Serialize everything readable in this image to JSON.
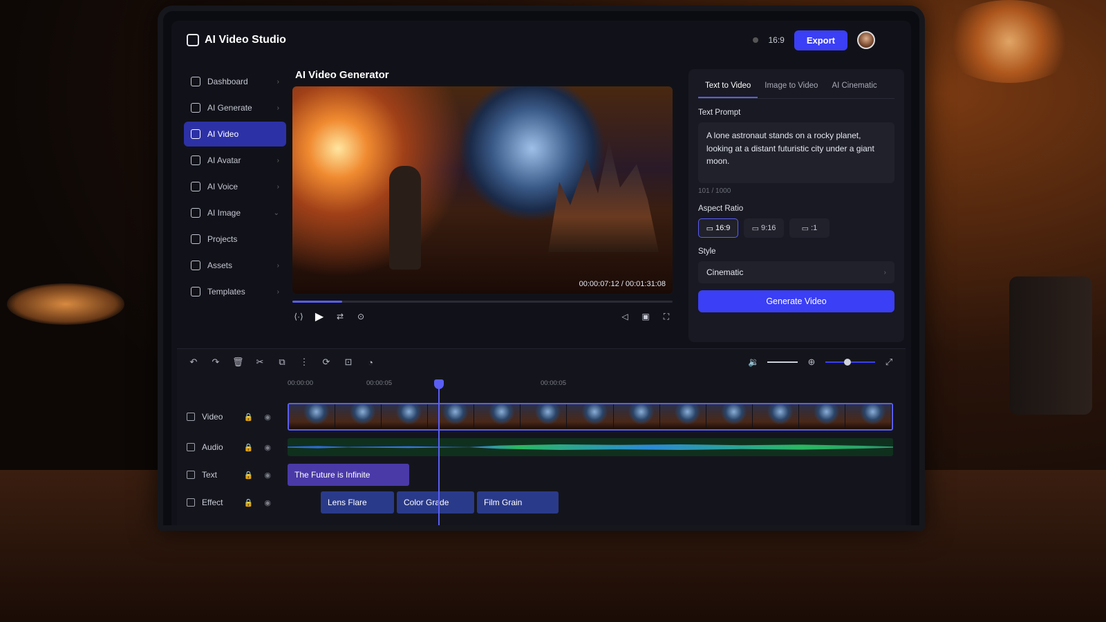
{
  "app": {
    "title": "AI Video Studio"
  },
  "topbar": {
    "ratio": "16:9",
    "export_label": "Export"
  },
  "sidebar": {
    "items": [
      {
        "label": "Dashboard",
        "icon": "home-icon",
        "active": false
      },
      {
        "label": "AI Generate",
        "icon": "sparkle-icon",
        "active": false
      },
      {
        "label": "AI Video",
        "icon": "video-icon",
        "active": true
      },
      {
        "label": "AI Avatar",
        "icon": "user-icon",
        "active": false
      },
      {
        "label": "AI Voice",
        "icon": "voice-icon",
        "active": false
      },
      {
        "label": "AI Image",
        "icon": "image-icon",
        "active": false
      },
      {
        "label": "Projects",
        "icon": "folder-icon",
        "active": false
      },
      {
        "label": "Assets",
        "icon": "box-icon",
        "active": false
      },
      {
        "label": "Templates",
        "icon": "template-icon",
        "active": false
      }
    ]
  },
  "main": {
    "title": "AI Video Generator",
    "timecode": "00:00:07:12 / 00:01:31:08",
    "progress": 0.13
  },
  "panel": {
    "tabs": [
      "Text to Video",
      "Image to Video",
      "AI Cinematic"
    ],
    "active_tab": 0,
    "prompt_label": "Text Prompt",
    "prompt_text": "A lone astronaut stands on a rocky planet, looking at a distant futuristic city under a giant moon.",
    "prompt_count": "101 / 1000",
    "aspect_label": "Aspect Ratio",
    "aspect_options": [
      "16:9",
      "9:16",
      ":1"
    ],
    "aspect_selected": 0,
    "style_label": "Style",
    "style_value": "Cinematic",
    "generate_label": "Generate Video"
  },
  "timeline": {
    "ruler": [
      "00:00:00",
      "00:00:05",
      "00:00:05"
    ],
    "tracks": [
      "Video",
      "Audio",
      "Text",
      "Effect"
    ],
    "text_clips": [
      "The Future is Infinite"
    ],
    "effect_clips": [
      "Lens Flare",
      "Color Grade",
      "Film Grain"
    ],
    "zoom_level": 0.45
  },
  "colors": {
    "accent": "#3b3ff5",
    "active_nav": "#2d31a6",
    "background": "#111219"
  }
}
